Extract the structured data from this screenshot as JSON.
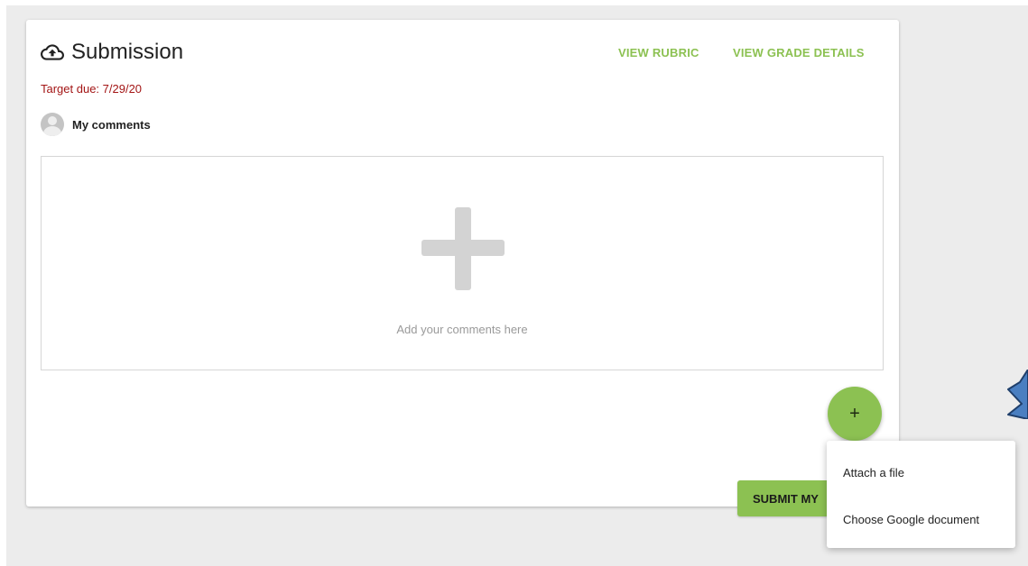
{
  "submission": {
    "title": "Submission",
    "title_icon": "cloud-upload-icon",
    "view_rubric": "VIEW RUBRIC",
    "view_grade_details": "VIEW GRADE DETAILS",
    "target_due": "Target due: 7/29/20",
    "comments_label": "My comments",
    "comment_placeholder": "Add your comments here",
    "submit_label": "SUBMIT MY",
    "fab_label": "+"
  },
  "add_menu": {
    "items": [
      {
        "label": "Attach a file"
      },
      {
        "label": "Choose Google document"
      }
    ]
  },
  "colors": {
    "accent": "#8cc152",
    "due_text": "#a31515",
    "annotation_arrow": "#4a7fc1"
  }
}
